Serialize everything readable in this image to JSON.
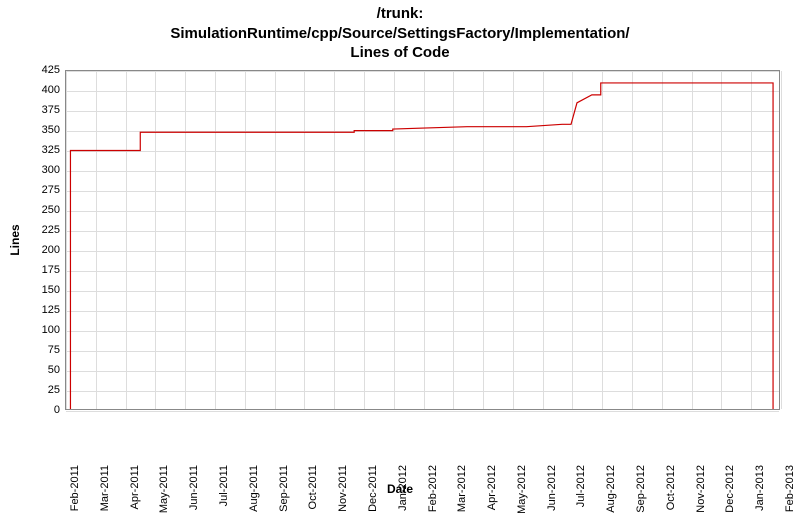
{
  "chart_data": {
    "type": "line",
    "title_line1": "/trunk:",
    "title_line2": "SimulationRuntime/cpp/Source/SettingsFactory/Implementation/",
    "title_line3": "Lines of Code",
    "xlabel": "Date",
    "ylabel": "Lines",
    "ylim": [
      0,
      425
    ],
    "y_ticks": [
      0,
      25,
      50,
      75,
      100,
      125,
      150,
      175,
      200,
      225,
      250,
      275,
      300,
      325,
      350,
      375,
      400,
      425
    ],
    "x_categories": [
      "Feb-2011",
      "Mar-2011",
      "Apr-2011",
      "May-2011",
      "Jun-2011",
      "Jul-2011",
      "Aug-2011",
      "Sep-2011",
      "Oct-2011",
      "Nov-2011",
      "Dec-2011",
      "Jan-2012",
      "Feb-2012",
      "Mar-2012",
      "Apr-2012",
      "May-2012",
      "Jun-2012",
      "Jul-2012",
      "Aug-2012",
      "Sep-2012",
      "Oct-2012",
      "Nov-2012",
      "Dec-2012",
      "Jan-2013",
      "Feb-2013"
    ],
    "series": [
      {
        "name": "Lines",
        "color": "#cc0000",
        "points": [
          {
            "x": 0.15,
            "y": 0
          },
          {
            "x": 0.15,
            "y": 325
          },
          {
            "x": 2.5,
            "y": 325
          },
          {
            "x": 2.5,
            "y": 348
          },
          {
            "x": 9.7,
            "y": 348
          },
          {
            "x": 9.7,
            "y": 350
          },
          {
            "x": 11.0,
            "y": 350
          },
          {
            "x": 11.0,
            "y": 352
          },
          {
            "x": 13.5,
            "y": 355
          },
          {
            "x": 15.5,
            "y": 355
          },
          {
            "x": 16.7,
            "y": 358
          },
          {
            "x": 17.0,
            "y": 358
          },
          {
            "x": 17.2,
            "y": 385
          },
          {
            "x": 17.7,
            "y": 395
          },
          {
            "x": 18.0,
            "y": 395
          },
          {
            "x": 18.0,
            "y": 410
          },
          {
            "x": 23.8,
            "y": 410
          },
          {
            "x": 23.8,
            "y": 0
          }
        ]
      }
    ]
  }
}
